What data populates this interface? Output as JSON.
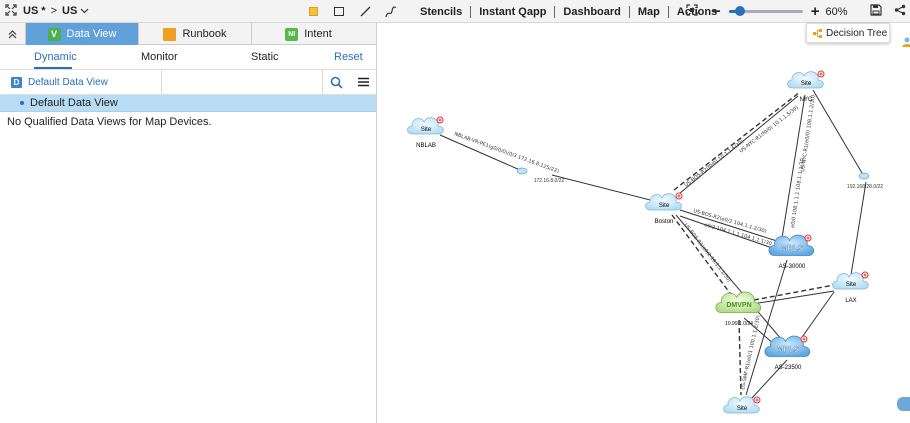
{
  "topbar": {
    "breadcrumb_part1": "US",
    "breadcrumb_mod": "*",
    "breadcrumb_sep": ">",
    "breadcrumb_part2": "US",
    "menu": [
      "Stencils",
      "Instant Qapp",
      "Dashboard",
      "Map",
      "Actions"
    ],
    "zoom": {
      "label": "60%",
      "level": 0.15
    }
  },
  "tabs": [
    {
      "label": "Data View",
      "badge": "V",
      "badge_color": "#4caf50",
      "active": true
    },
    {
      "label": "Runbook",
      "badge": "",
      "badge_color": "#f0a020",
      "active": false
    },
    {
      "label": "Intent",
      "badge": "NI",
      "badge_color": "#58b947",
      "active": false
    }
  ],
  "subtabs": {
    "dynamic": "Dynamic",
    "monitor": "Monitor",
    "static": "Static",
    "reset": "Reset"
  },
  "dataview": {
    "badge": "D",
    "selected": "Default Data View",
    "item": "Default Data View",
    "empty_msg": "No Qualified Data Views for Map Devices."
  },
  "decision_tree": {
    "label": "Decision Tree"
  },
  "map": {
    "sites": [
      {
        "id": "nblab",
        "name": "NBLAB",
        "kind": "Site"
      },
      {
        "id": "nyc",
        "name": "NYC",
        "kind": "Site"
      },
      {
        "id": "boston",
        "name": "Boston",
        "kind": "Site"
      },
      {
        "id": "lax",
        "name": "LAX",
        "kind": "Site"
      },
      {
        "id": "bottom",
        "name": "",
        "kind": "Site"
      }
    ],
    "clouds": [
      {
        "id": "mpls1",
        "label": "MPLS",
        "sub": "AS-30000"
      },
      {
        "id": "dmvpn",
        "label": "DMVPN",
        "sub": "10.99.1.0/24"
      },
      {
        "id": "mpls2",
        "label": "MPLS",
        "sub": "AS-23500"
      }
    ],
    "subnets": [
      {
        "id": "s1",
        "label": "172.16.8.0/22"
      },
      {
        "id": "s2",
        "label": "192.168.28.0/22"
      }
    ],
    "links": [
      {
        "text": "NBLAB-VR-PE1(g0/0/0)/0/3 172.16.8.125/22)"
      },
      {
        "text": "US-BOS-R2(f0/0) 10.1.1.6/30)"
      },
      {
        "text": "US-NYC-R1(f0/0) 10.1.1.5/30)"
      },
      {
        "text": "US-NYC-R1(e0/0) 108.1.1.2/30)"
      },
      {
        "text": "e0/0 108.1.1.1 108.1.1.1/30"
      },
      {
        "text": "US-BOS-R2(e0/2 104.1.1.2/30)"
      },
      {
        "text": "e0/2 104.1.1.1 104.1.1.1/30"
      },
      {
        "text": "US-BOS-R1(e0/2 10.1.1.1/30)"
      },
      {
        "text": "US-SMF-R1(e0/1 100.1.1.2/30)"
      }
    ]
  }
}
